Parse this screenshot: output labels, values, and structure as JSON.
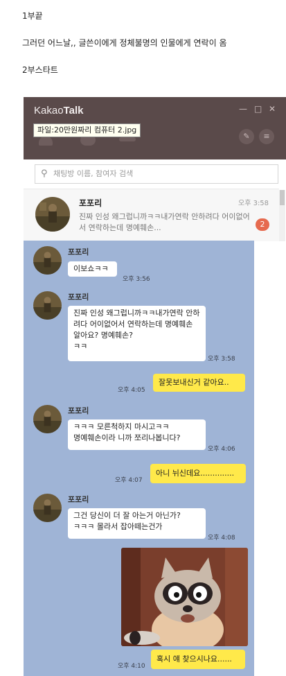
{
  "post": {
    "line1": "1부끝",
    "line2": "그러던 어느날,, 글쓴이에게 정체불명의 인물에게 연락이 옴",
    "line3": "2부스타트"
  },
  "kakao": {
    "logo_light": "Kakao",
    "logo_bold": "Talk",
    "controls": {
      "minimize": "—",
      "maximize": "□",
      "close": "✕"
    },
    "tooltip": "파일:20만원짜리 컴퓨터 2.jpg",
    "search_placeholder": "채팅방 이름, 참여자 검색",
    "chat_row": {
      "name": "포포리",
      "time": "오후 3:58",
      "preview": "진짜 인성 왜그럽니까ㅋㅋ내가연락 안하려다 어이없어서 연락하는데 명예훼손...",
      "unread": "2"
    }
  },
  "chat": {
    "messages": [
      {
        "sender": "포포리",
        "text": "이보쇼ㅋㅋ",
        "time": "오후 3:56"
      },
      {
        "sender": "포포리",
        "text": "진짜 인성 왜그럽니까ㅋㅋ내가연락 안하려다 어이없어서 연락하는데 명예훼손 알아요? 명예훼손?\nㅋㅋ",
        "time": "오후 3:58"
      },
      {
        "me": true,
        "text": "잘못보내신거 같아요..",
        "time": "오후 4:05"
      },
      {
        "sender": "포포리",
        "text": "ㅋㅋㅋ 모른척하지 마시고ㅋㅋ\n명예훼손이라 니까 쪼리나봅니다?",
        "time": "오후 4:06"
      },
      {
        "me": true,
        "text": "아니 뉘신데요..............",
        "time": "오후 4:07"
      },
      {
        "sender": "포포리",
        "text": "그건 당신이 더 잘 아는거 아닌가?\nㅋㅋㅋ 몰라서 잡아떼는건가",
        "time": "오후 4:08"
      },
      {
        "me": true,
        "text": "혹시 얘 찾으시나요......",
        "time": "오후 4:10"
      }
    ]
  },
  "colors": {
    "titlebar": "#5a4a4a",
    "chat_bg": "#9fb4d6",
    "my_bubble": "#ffe94a",
    "badge": "#e66a4e"
  }
}
